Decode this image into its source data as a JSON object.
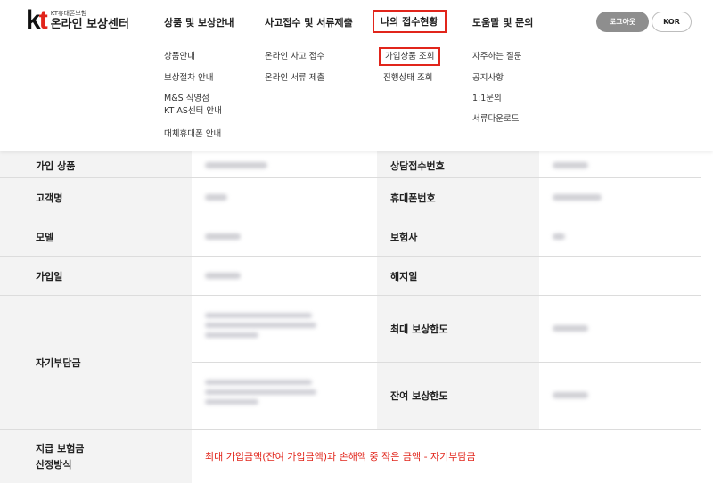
{
  "header": {
    "logo": {
      "kt_k": "k",
      "kt_t": "t",
      "sub": "KT휴대폰보험",
      "title": "온라인 보상센터"
    },
    "nav": [
      {
        "label": "상품 및 보상안내",
        "items": [
          "상품안내",
          "보상절차 안내",
          "M&S 직영점",
          "KT AS센터 안내",
          "대체휴대폰 안내"
        ]
      },
      {
        "label": "사고접수 및 서류제출",
        "items": [
          "온라인 사고 접수",
          "온라인 서류 제출"
        ]
      },
      {
        "label": "나의 접수현황",
        "items": [
          "가입상품 조회",
          "진행상태 조회"
        ]
      },
      {
        "label": "도움말 및 문의",
        "items": [
          "자주하는 질문",
          "공지사항",
          "1:1문의",
          "서류다운로드"
        ]
      }
    ],
    "logout": "로그아웃",
    "lang": "KOR"
  },
  "table": {
    "row1": {
      "label": "가입 상품",
      "label2": "상담접수번호"
    },
    "row2": {
      "label": "고객명",
      "label2": "휴대폰번호"
    },
    "row3": {
      "label": "모델",
      "label2": "보험사"
    },
    "row4": {
      "label": "가입일",
      "label2": "해지일"
    },
    "row5": {
      "label": "자기부담금",
      "label2a": "최대 보상한도",
      "label2b": "잔여 보상한도"
    },
    "row6": {
      "label_line1": "지급 보험금",
      "label_line2": "산정방식",
      "note": "최대 가입금액(잔여 가입금액)과 손해액 중 작은 금액 - 자기부담금"
    }
  }
}
